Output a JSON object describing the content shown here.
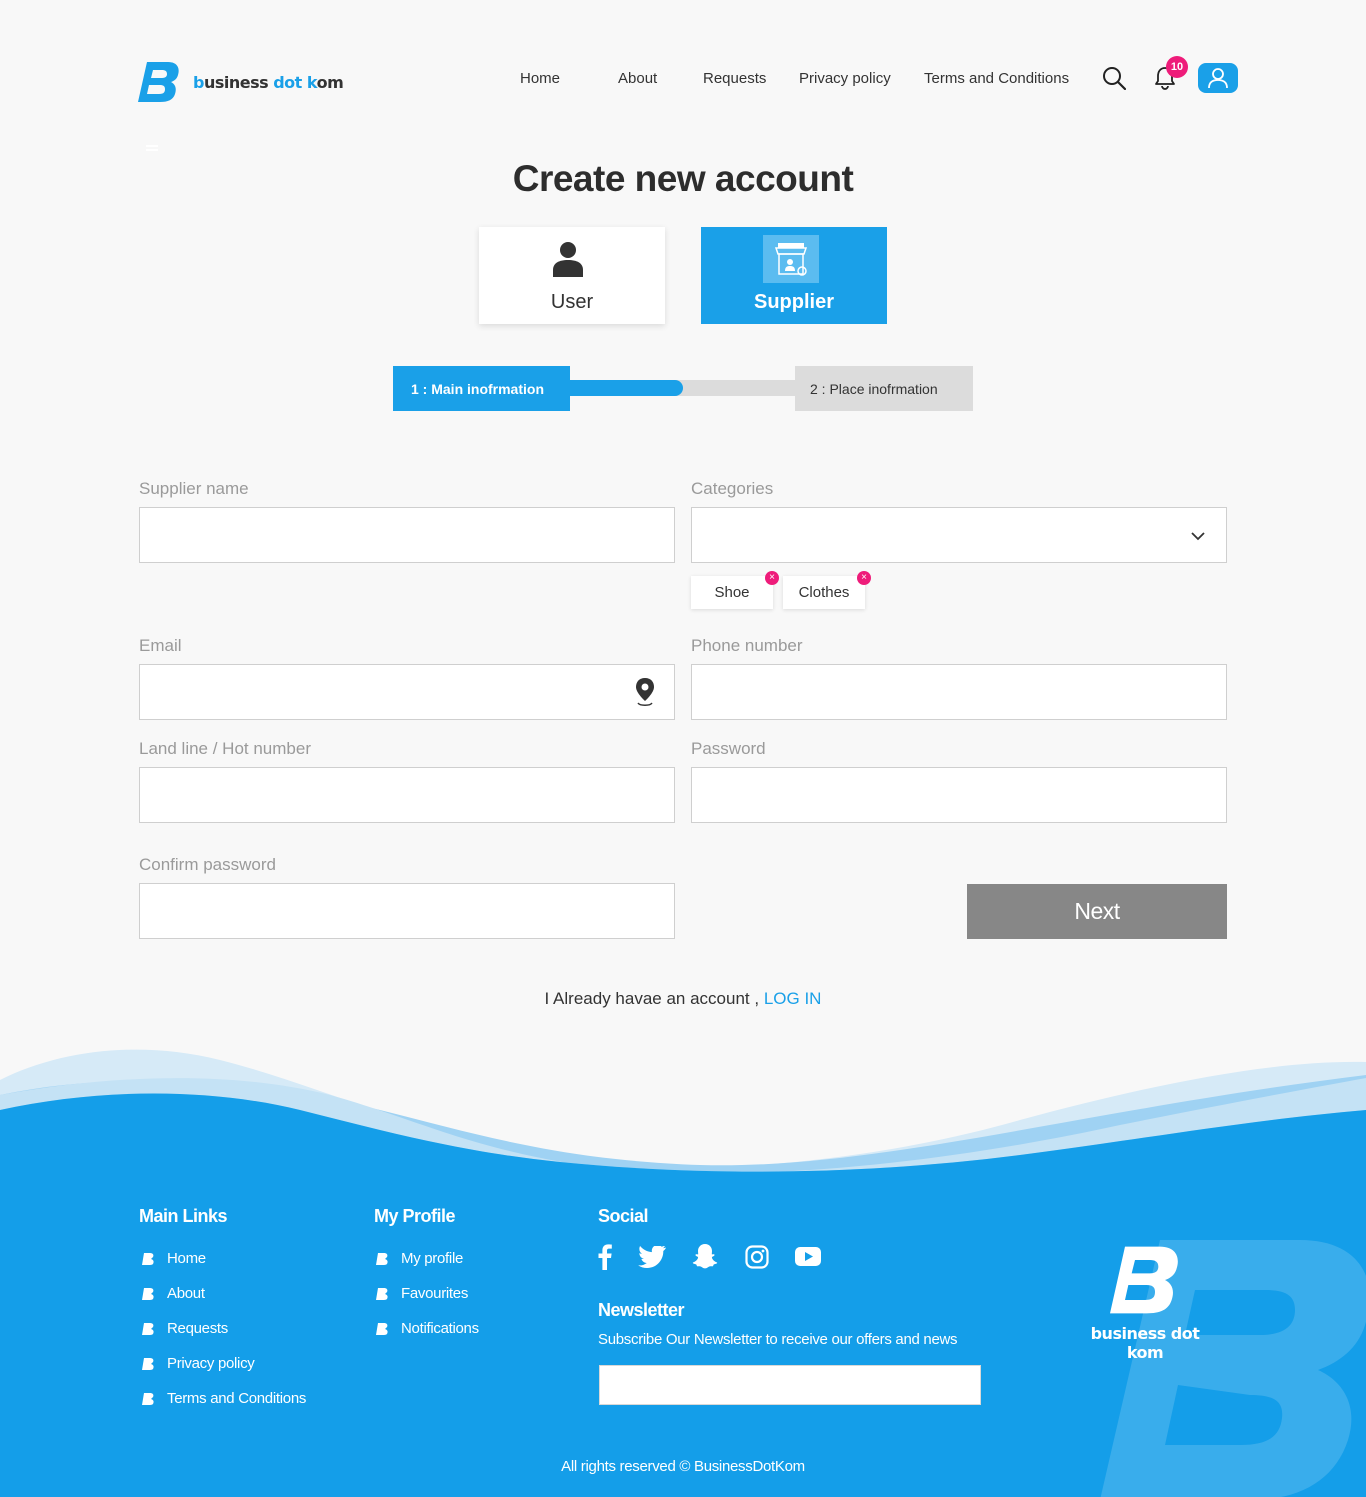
{
  "header": {
    "logo_word_1": "business",
    "logo_word_2": "dot",
    "logo_word_3": "kom",
    "nav": [
      "Home",
      "About",
      "Requests",
      "Privacy policy",
      "Terms and Conditions"
    ],
    "notification_count": "10",
    "icons": {
      "search": "search-icon",
      "notifications": "bell-icon",
      "account": "user-icon"
    }
  },
  "page_title": "Create new account",
  "account_types": {
    "user": "User",
    "supplier": "Supplier",
    "selected": "Supplier"
  },
  "steps": {
    "step1": "1 : Main inofrmation",
    "step2": "2 : Place inofrmation",
    "progress": 0.5
  },
  "form": {
    "supplier_name": {
      "label": "Supplier name",
      "value": ""
    },
    "categories": {
      "label": "Categories",
      "value": "",
      "tags": [
        "Shoe",
        "Clothes"
      ]
    },
    "email": {
      "label": "Email",
      "value": ""
    },
    "phone": {
      "label": "Phone number",
      "value": ""
    },
    "landline": {
      "label": "Land line / Hot number",
      "value": ""
    },
    "password": {
      "label": "Password",
      "value": ""
    },
    "confirm_password": {
      "label": "Confirm password",
      "value": ""
    },
    "next": "Next"
  },
  "login_prompt": {
    "text": "I Already havae an account ,",
    "link": "LOG IN"
  },
  "footer": {
    "main_links": {
      "title": "Main Links",
      "items": [
        "Home",
        "About",
        "Requests",
        "Privacy policy",
        "Terms and Conditions"
      ]
    },
    "my_profile": {
      "title": "My Profile",
      "items": [
        "My profile",
        "Favourites",
        "Notifications"
      ]
    },
    "social": {
      "title": "Social",
      "icons": [
        "facebook-icon",
        "twitter-icon",
        "snapchat-icon",
        "instagram-icon",
        "youtube-icon"
      ]
    },
    "newsletter": {
      "title": "Newsletter",
      "text": "Subscribe Our Newsletter to receive our offers and news",
      "value": ""
    },
    "logo_text": "business dot kom",
    "copyright": "All rights reserved © BusinessDotKom"
  },
  "colors": {
    "brand": "#1aa0e8",
    "badge": "#ee1c7a",
    "button_disabled": "#878787"
  }
}
